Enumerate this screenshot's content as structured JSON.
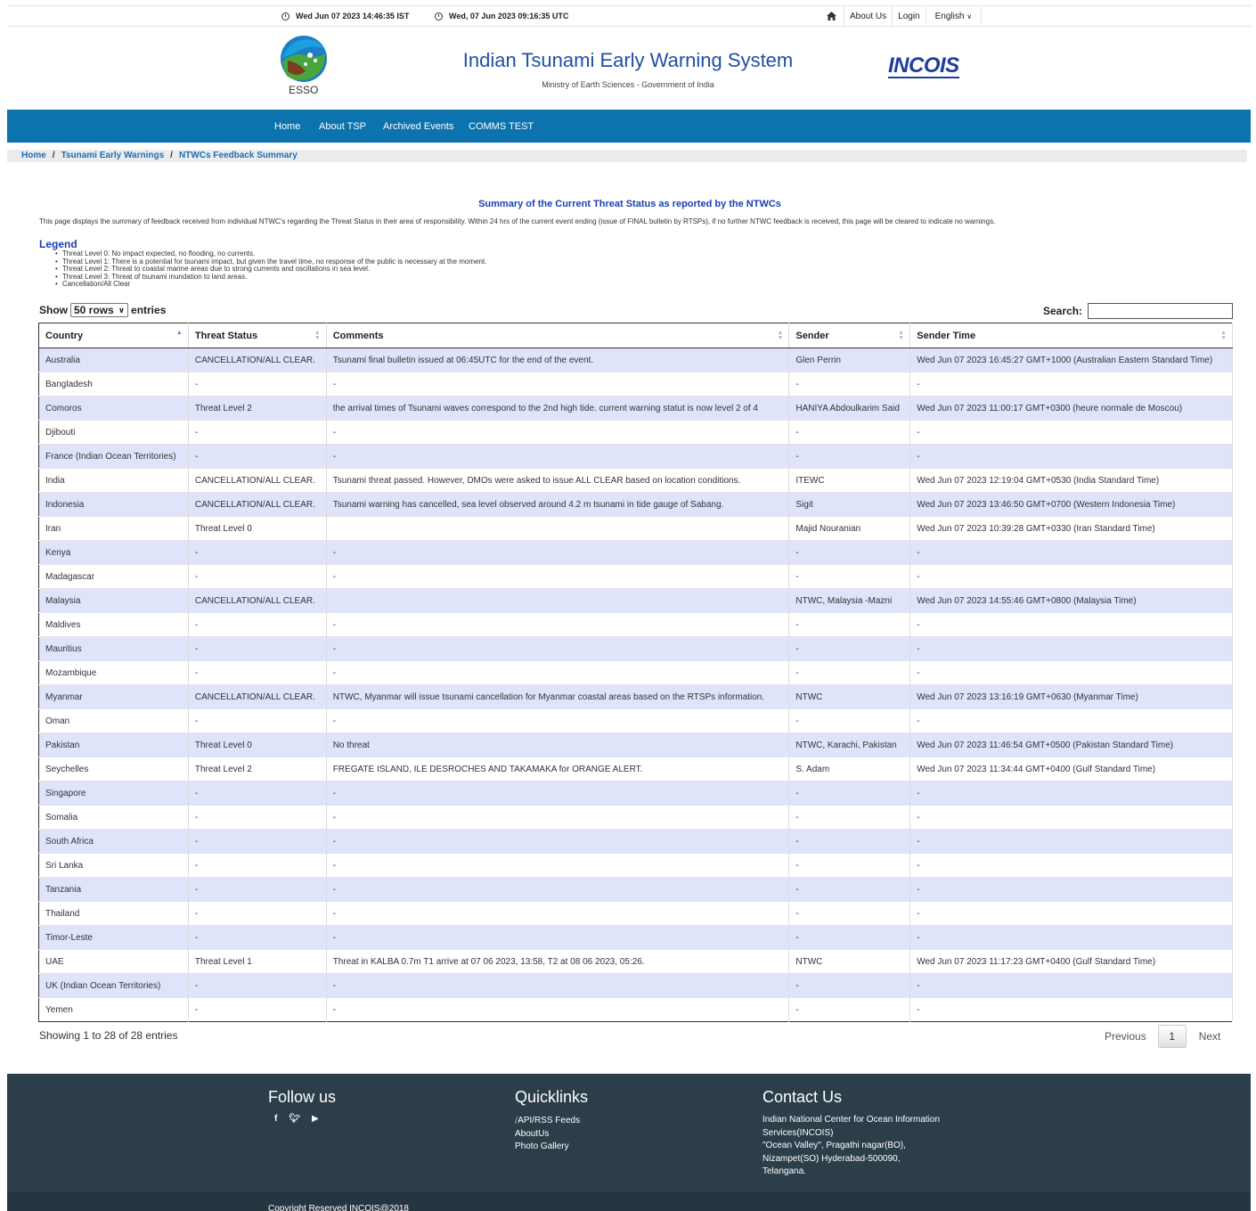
{
  "topbar": {
    "ist_time": "Wed Jun 07 2023 14:46:35 IST",
    "utc_time": "Wed, 07 Jun 2023 09:16:35 UTC",
    "about": "About Us",
    "login": "Login",
    "language": "English"
  },
  "header": {
    "esso_label": "ESSO",
    "title": "Indian Tsunami Early Warning System",
    "subtitle": "Ministry of Earth Sciences - Government of India",
    "incois_logo": "INCOIS"
  },
  "nav": [
    "Home",
    "About TSP",
    "Archived Events",
    "COMMS TEST"
  ],
  "breadcrumb": [
    "Home",
    "Tsunami Early Warnings",
    "NTWCs Feedback Summary"
  ],
  "content": {
    "title": "Summary of the Current Threat Status as reported by the NTWCs",
    "intro": "This page displays the summary of feedback received from individual NTWC's regarding the Threat Status in their area of responsibility. Within 24 hrs of the current event ending (issue of FINAL bulletin by RTSPs), if no further NTWC feedback is received, this page will be cleared to indicate no warnings.",
    "legend_title": "Legend",
    "legend": [
      "Threat Level 0: No impact expected, no flooding, no currents.",
      "Threat Level 1: There is a potential for tsunami impact, but given the travel time, no response of the public is necessary at the moment.",
      "Threat Level 2: Threat to coastal marine areas due to strong currents and oscillations in sea level.",
      "Threat Level 3: Threat of tsunami inundation to land areas.",
      "Cancellation/All Clear"
    ]
  },
  "table_controls": {
    "show_label": "Show",
    "rows_option": "50 rows",
    "entries_label": "entries",
    "search_label": "Search:"
  },
  "table": {
    "headers": [
      "Country",
      "Threat Status",
      "Comments",
      "Sender",
      "Sender Time"
    ],
    "rows": [
      [
        "Australia",
        "CANCELLATION/ALL CLEAR.",
        "Tsunami final bulletin issued at 06:45UTC for the end of the event.",
        "Glen Perrin",
        "Wed Jun 07 2023 16:45:27 GMT+1000 (Australian Eastern Standard Time)"
      ],
      [
        "Bangladesh",
        "-",
        "-",
        "-",
        "-"
      ],
      [
        "Comoros",
        "Threat Level 2",
        "the arrival times of Tsunami waves correspond to the 2nd high tide. current warning statut is now level 2 of 4",
        "HANIYA Abdoulkarim Said",
        "Wed Jun 07 2023 11:00:17 GMT+0300 (heure normale de Moscou)"
      ],
      [
        "Djibouti",
        "-",
        "-",
        "-",
        "-"
      ],
      [
        "France (Indian Ocean Territories)",
        "-",
        "-",
        "-",
        "-"
      ],
      [
        "India",
        "CANCELLATION/ALL CLEAR.",
        "Tsunami threat passed. However, DMOs were asked to issue ALL CLEAR based on location conditions.",
        "ITEWC",
        "Wed Jun 07 2023 12:19:04 GMT+0530 (India Standard Time)"
      ],
      [
        "Indonesia",
        "CANCELLATION/ALL CLEAR.",
        "Tsunami warning has cancelled, sea level observed around 4.2 m tsunami in tide gauge of Sabang.",
        "Sigit",
        "Wed Jun 07 2023 13:46:50 GMT+0700 (Western Indonesia Time)"
      ],
      [
        "Iran",
        "Threat Level 0",
        "",
        "Majid Nouranian",
        "Wed Jun 07 2023 10:39:28 GMT+0330 (Iran Standard Time)"
      ],
      [
        "Kenya",
        "-",
        "-",
        "-",
        "-"
      ],
      [
        "Madagascar",
        "-",
        "-",
        "-",
        "-"
      ],
      [
        "Malaysia",
        "CANCELLATION/ALL CLEAR.",
        "",
        "NTWC, Malaysia -Mazni",
        "Wed Jun 07 2023 14:55:46 GMT+0800 (Malaysia Time)"
      ],
      [
        "Maldives",
        "-",
        "-",
        "-",
        "-"
      ],
      [
        "Mauritius",
        "-",
        "-",
        "-",
        "-"
      ],
      [
        "Mozambique",
        "-",
        "-",
        "-",
        "-"
      ],
      [
        "Myanmar",
        "CANCELLATION/ALL CLEAR.",
        "NTWC, Myanmar will issue tsunami cancellation for Myanmar coastal areas based on the RTSPs information.",
        "NTWC",
        "Wed Jun 07 2023 13:16:19 GMT+0630 (Myanmar Time)"
      ],
      [
        "Oman",
        "-",
        "-",
        "-",
        "-"
      ],
      [
        "Pakistan",
        "Threat Level 0",
        "No threat",
        "NTWC, Karachi, Pakistan",
        "Wed Jun 07 2023 11:46:54 GMT+0500 (Pakistan Standard Time)"
      ],
      [
        "Seychelles",
        "Threat Level 2",
        "FREGATE ISLAND, ILE DESROCHES AND TAKAMAKA for ORANGE ALERT.",
        "S. Adam",
        "Wed Jun 07 2023 11:34:44 GMT+0400 (Gulf Standard Time)"
      ],
      [
        "Singapore",
        "-",
        "-",
        "-",
        "-"
      ],
      [
        "Somalia",
        "-",
        "-",
        "-",
        "-"
      ],
      [
        "South Africa",
        "-",
        "-",
        "-",
        "-"
      ],
      [
        "Sri Lanka",
        "-",
        "-",
        "-",
        "-"
      ],
      [
        "Tanzania",
        "-",
        "-",
        "-",
        "-"
      ],
      [
        "Thailand",
        "-",
        "-",
        "-",
        "-"
      ],
      [
        "Timor-Leste",
        "-",
        "-",
        "-",
        "-"
      ],
      [
        "UAE",
        "Threat Level 1",
        "Threat in KALBA 0.7m T1 arrive at 07 06 2023, 13:58, T2 at 08 06 2023, 05:26.",
        "NTWC",
        "Wed Jun 07 2023 11:17:23 GMT+0400 (Gulf Standard Time)"
      ],
      [
        "UK (Indian Ocean Territories)",
        "-",
        "-",
        "-",
        "-"
      ],
      [
        "Yemen",
        "-",
        "-",
        "-",
        "-"
      ]
    ]
  },
  "pagination": {
    "info": "Showing 1 to 28 of 28 entries",
    "previous": "Previous",
    "page": "1",
    "next": "Next"
  },
  "footer": {
    "follow_title": "Follow us",
    "quicklinks_title": "Quicklinks",
    "quicklinks": [
      "API/RSS Feeds",
      "AboutUs",
      "Photo Gallery"
    ],
    "contact_title": "Contact Us",
    "contact_lines": [
      "Indian National Center for Ocean Information",
      "Services(INCOIS)",
      "\"Ocean Valley\", Pragathi nagar(BO),",
      "Nizampet(SO) Hyderabad-500090,",
      "Telangana."
    ],
    "copyright": "Copyright Reserved INCOIS@2018"
  },
  "colors": {
    "nav_blue": "#0d73ae",
    "link_blue": "#1f6cb3",
    "title_blue": "#1a3fb3",
    "row_stripe": "#dfe4fb",
    "footer_bg": "#2c3e49"
  }
}
